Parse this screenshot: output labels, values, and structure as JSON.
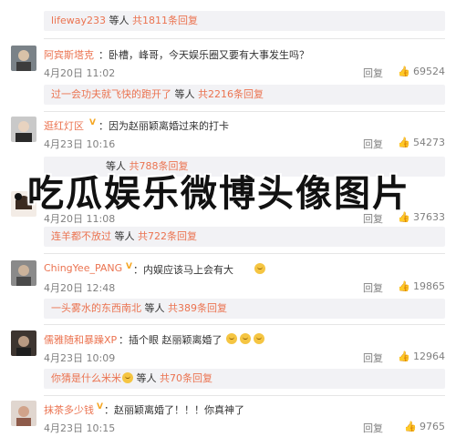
{
  "comments": [
    {
      "user": "阿宾斯塔克",
      "text": "：卧槽，峰哥，今天娱乐圈又要有大事发生吗？",
      "time": "4月20日 11:02",
      "reply_label": "回复",
      "likes": "69524"
    },
    {
      "user": "逛红灯区",
      "text": "：因为赵丽颖离婚过来的打卡",
      "time": "4月23日 10:16",
      "reply_label": "回复",
      "likes": "54273"
    },
    {
      "user": "",
      "text": "",
      "time": "4月20日 11:08",
      "reply_label": "回复",
      "likes": "37633"
    },
    {
      "user": "ChingYee_PANG",
      "text": "：内娱应该马上会有大",
      "time": "4月20日 12:48",
      "reply_label": "回复",
      "likes": "19865"
    },
    {
      "user": "儒雅随和暴躁XP",
      "text": "：插个眼 赵丽颖离婚了",
      "time": "4月23日 10:09",
      "reply_label": "回复",
      "likes": "12964"
    },
    {
      "user": "抹茶多少钱",
      "text": "：赵丽颖离婚了！！！你真神了",
      "time": "4月23日 10:15",
      "reply_label": "回复",
      "likes": "9765"
    }
  ],
  "replies": [
    {
      "user": "lifeway233",
      "mid": " 等人 ",
      "link": "共1811条回复"
    },
    {
      "user": "过一会功夫就飞快的跑开了",
      "mid": " 等人 ",
      "link": "共2216条回复"
    },
    {
      "user": "",
      "mid": " 等人 ",
      "link": "共788条回复"
    },
    {
      "user": "连羊都不放过",
      "mid": " 等人 ",
      "link": "共722条回复"
    },
    {
      "user": "一头雾水的东西南北",
      "mid": " 等人 ",
      "link": "共389条回复"
    },
    {
      "user": "你猜是什么米米",
      "mid": " 等人 ",
      "link": "共70条回复"
    }
  ],
  "overlay": {
    "title": "吃瓜娱乐微博头像图片"
  },
  "icons": {
    "like": "thumbs-up-icon",
    "emoji": "smiley-emoji-icon"
  },
  "colors": {
    "username": "#eb7350",
    "meta": "#808080",
    "reply_bg": "#f2f2f5"
  }
}
